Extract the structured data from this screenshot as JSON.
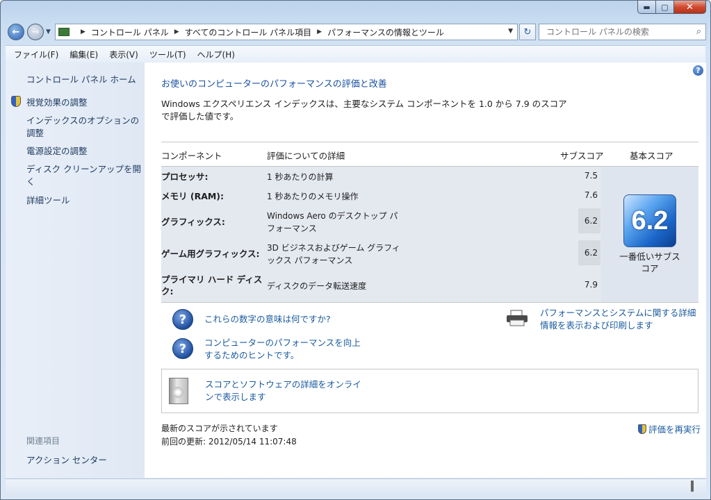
{
  "window": {
    "minimize_icon": "minimize-icon",
    "maximize_icon": "maximize-icon",
    "close_icon": "close-icon"
  },
  "address": {
    "crumbs": [
      "コントロール パネル",
      "すべてのコントロール パネル項目",
      "パフォーマンスの情報とツール"
    ]
  },
  "search": {
    "placeholder": "コントロール パネルの検索"
  },
  "menu": [
    "ファイル(F)",
    "編集(E)",
    "表示(V)",
    "ツール(T)",
    "ヘルプ(H)"
  ],
  "sidebar": {
    "home": "コントロール パネル ホーム",
    "items": [
      "視覚効果の調整",
      "インデックスのオプションの調整",
      "電源設定の調整",
      "ディスク クリーンアップを開く",
      "詳細ツール"
    ],
    "related_title": "関連項目",
    "related": [
      "アクション センター"
    ]
  },
  "main": {
    "title": "お使いのコンピューターのパフォーマンスの評価と改善",
    "description": "Windows エクスペリエンス インデックスは、主要なシステム コンポーネントを 1.0 から 7.9 のスコアで評価した値です。",
    "table": {
      "headers": [
        "コンポーネント",
        "評価についての詳細",
        "サブスコア",
        "基本スコア"
      ],
      "rows": [
        {
          "component": "プロセッサ:",
          "detail": "1 秒あたりの計算",
          "subscore": "7.5"
        },
        {
          "component": "メモリ (RAM):",
          "detail": "1 秒あたりのメモリ操作",
          "subscore": "7.6"
        },
        {
          "component": "グラフィックス:",
          "detail": "Windows Aero のデスクトップ パフォーマンス",
          "subscore": "6.2"
        },
        {
          "component": "ゲーム用グラフィックス:",
          "detail": "3D ビジネスおよびゲーム グラフィックス パフォーマンス",
          "subscore": "6.2"
        },
        {
          "component": "プライマリ ハード ディスク:",
          "detail": "ディスクのデータ転送速度",
          "subscore": "7.9"
        }
      ],
      "base_score": "6.2",
      "base_label": "一番低いサブスコア"
    },
    "links": {
      "meaning": "これらの数字の意味は何ですか?",
      "tips": "コンピューターのパフォーマンスを向上するためのヒントです。",
      "print": "パフォーマンスとシステムに関する詳細情報を表示および印刷します",
      "online": "スコアとソフトウェアの詳細をオンラインで表示します"
    },
    "status": {
      "current": "最新のスコアが示されています",
      "last_update": "前回の更新: 2012/05/14 11:07:48",
      "rerun": "評価を再実行"
    }
  }
}
